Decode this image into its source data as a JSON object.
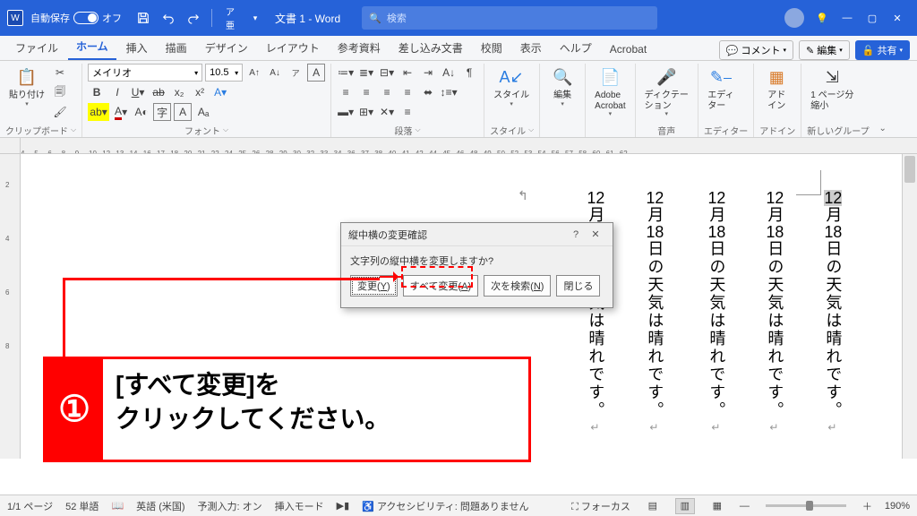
{
  "titlebar": {
    "autosave": "自動保存",
    "autosave_state": "オフ",
    "doc": "文書 1 - Word",
    "search": "検索"
  },
  "tabs": [
    "ファイル",
    "ホーム",
    "挿入",
    "描画",
    "デザイン",
    "レイアウト",
    "参考資料",
    "差し込み文書",
    "校閲",
    "表示",
    "ヘルプ",
    "Acrobat"
  ],
  "active_tab": 1,
  "rtabs": {
    "comment": "コメント",
    "edit": "編集",
    "share": "共有"
  },
  "groups": {
    "clipboard": "クリップボード",
    "paste": "貼り付け",
    "font": "フォント",
    "paragraph": "段落",
    "style": "スタイル",
    "edit": "編集",
    "acrobat": "Adobe\nAcrobat",
    "dictation": "ディクテー\nション",
    "editor": "エディ\nター",
    "addin": "アド\nイン",
    "pageshrink": "1 ページ分\n縮小"
  },
  "group_labels": {
    "clipboard": "クリップボード",
    "font": "フォント",
    "paragraph": "段落",
    "style": "スタイル",
    "audio": "音声",
    "editor": "エディター",
    "addin": "アドイン",
    "newgroup": "新しいグループ"
  },
  "font": {
    "name": "メイリオ",
    "size": "10.5"
  },
  "ruler_ticks": [
    4,
    5,
    6,
    8,
    9,
    10,
    12,
    13,
    14,
    16,
    17,
    18,
    20,
    21,
    22,
    24,
    25,
    26,
    28,
    29,
    30,
    32,
    33,
    34,
    36,
    37,
    38,
    40,
    41,
    42,
    44,
    45,
    46,
    48,
    49,
    50,
    52,
    53,
    54,
    56,
    57,
    58,
    60,
    61,
    62
  ],
  "vruler_ticks": [
    2,
    4,
    6,
    8
  ],
  "vtext": "12月18日の天気は晴れです。",
  "dialog": {
    "title": "縦中横の変更確認",
    "msg": "文字列の縦中横を変更しますか?",
    "change": "変更",
    "change_key": "Y",
    "change_all": "すべて変更",
    "change_all_key": "A",
    "find_next": "次を検索",
    "find_next_key": "N",
    "close": "閉じる"
  },
  "callout": {
    "num": "①",
    "l1": "[すべて変更]を",
    "l2": "クリックしてください。"
  },
  "status": {
    "page": "1/1 ページ",
    "words": "52 単語",
    "lang": "英語 (米国)",
    "predict": "予測入力: オン",
    "insert": "挿入モード",
    "a11y": "アクセシビリティ: 問題ありません",
    "focus": "フォーカス",
    "zoom": "190%"
  }
}
